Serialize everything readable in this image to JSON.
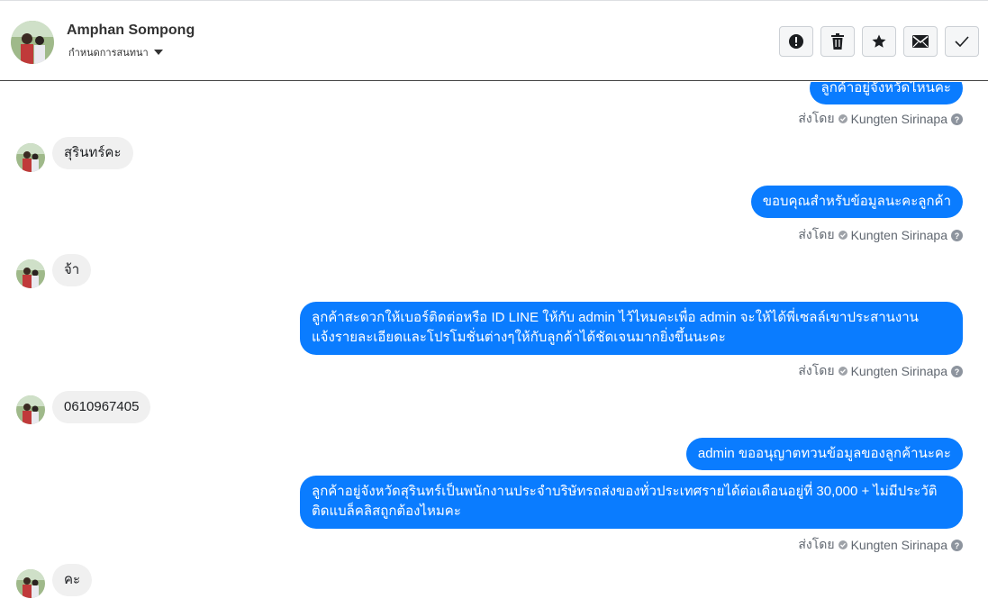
{
  "header": {
    "name": "Amphan Sompong",
    "subtitle": "กำหนดการสนทนา",
    "actions": [
      "alert-icon",
      "trash-icon",
      "star-icon",
      "mail-icon",
      "check-icon"
    ]
  },
  "messages": {
    "out_0": "ลูกค้าอยู่จังหวัดไหนคะ",
    "in_1": "สุรินทร์คะ",
    "out_2": "ขอบคุณสำหรับข้อมูลนะคะลูกค้า",
    "in_3": "จ้า",
    "out_4_line1": "ลูกค้าสะดวกให้เบอร์ติดต่อหรือ ID LINE ให้กับ admin ไว้ไหมคะเพื่อ admin จะให้ได้พี่เซลล์เขาประสานงาน",
    "out_4_line2": "แจ้งรายละเอียดและโปรโมชั่นต่างๆให้กับลูกค้าได้ชัดเจนมากยิ่งขึ้นนะคะ",
    "in_5": "0610967405",
    "out_6": "admin ขออนุญาตทวนข้อมูลของลูกค้านะคะ",
    "out_7_line1": "ลูกค้าอยู่จังหวัดสุรินทร์เป็นพนักงานประจำบริษัทรถส่งของทั่วประเทศรายได้ต่อเดือนอยู่ที่ 30,000 + ไม่มีประวัติ",
    "out_7_line2": "ติดแบล็คลิสถูกต้องไหมคะ",
    "in_8": "คะ"
  },
  "sent_by": {
    "prefix": "ส่งโดย",
    "agent": "Kungten Sirinapa"
  },
  "colors": {
    "outgoing_bubble": "#0a7cff",
    "incoming_bubble": "#f0f0f0"
  }
}
